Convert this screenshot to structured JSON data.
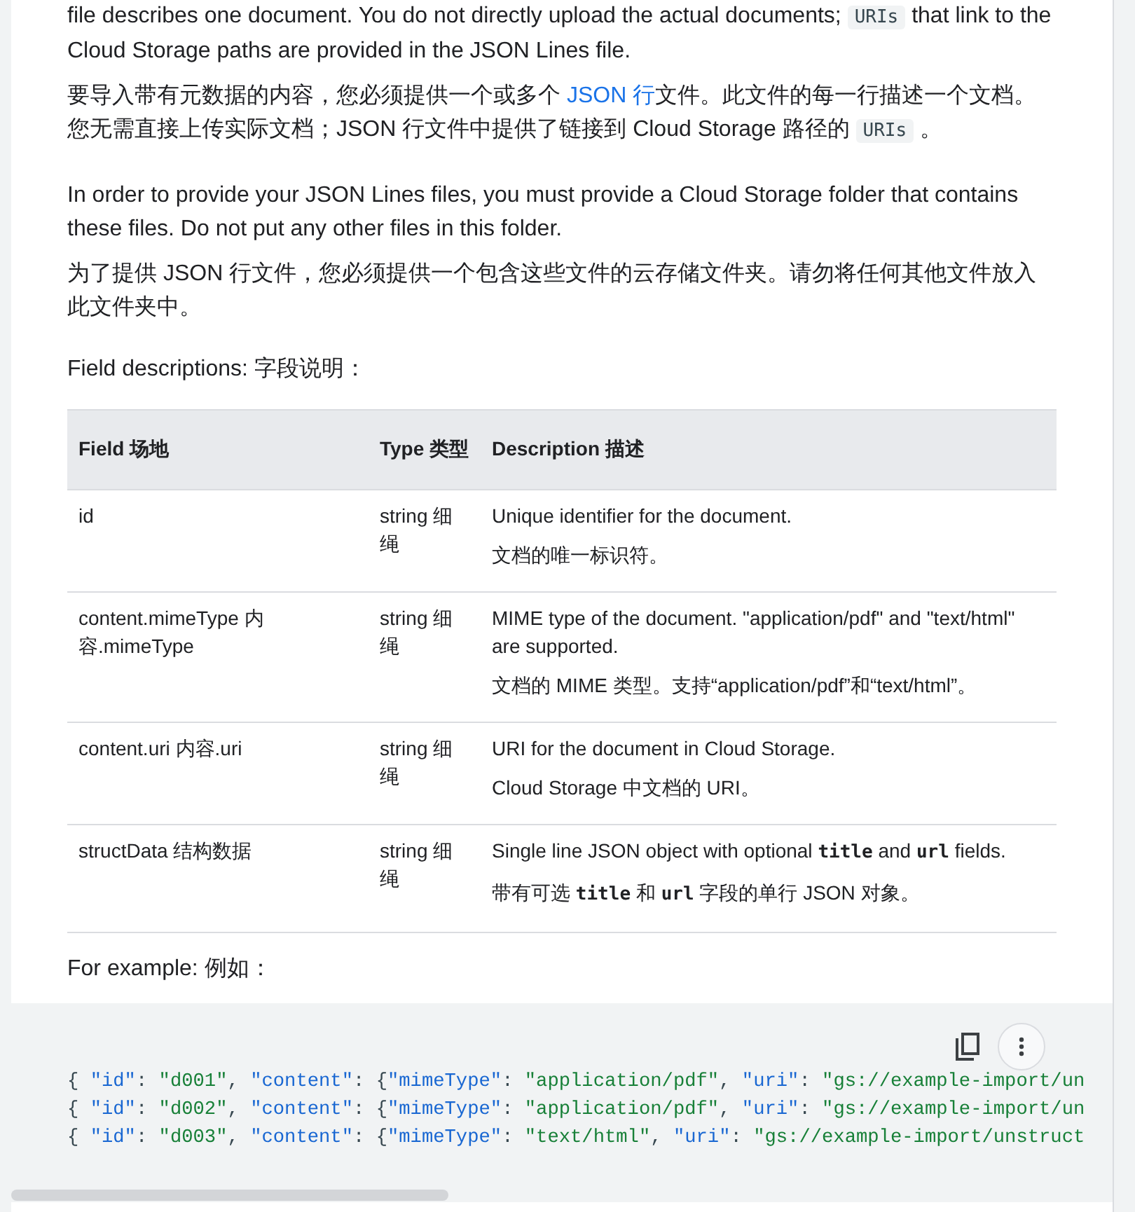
{
  "groups": [
    {
      "en": [
        {
          "kind": "text",
          "text": "file describes one document. You do not directly upload the actual documents; "
        },
        {
          "kind": "code",
          "text": "URIs"
        },
        {
          "kind": "text",
          "text": " that link to the Cloud Storage paths are provided in the JSON Lines file."
        }
      ],
      "zh": [
        {
          "kind": "text",
          "text": "要导入带有元数据的内容，您必须提供一个或多个 "
        },
        {
          "kind": "link",
          "text": "JSON 行"
        },
        {
          "kind": "text",
          "text": "文件。此文件的每一行描述一个文档。您无需直接上传实际文档；JSON 行文件中提供了链接到 Cloud Storage 路径的 "
        },
        {
          "kind": "code",
          "text": "URIs"
        },
        {
          "kind": "text",
          "text": " 。"
        }
      ]
    },
    {
      "en": [
        {
          "kind": "text",
          "text": "In order to provide your JSON Lines files, you must provide a Cloud Storage folder that contains these files. Do not put any other files in this folder."
        }
      ],
      "zh": [
        {
          "kind": "text",
          "text": "为了提供 JSON 行文件，您必须提供一个包含这些文件的云存储文件夹。请勿将任何其他文件放入此文件夹中。"
        }
      ]
    }
  ],
  "table_intro": "Field descriptions:  字段说明：",
  "table": {
    "columns": [
      "Field  场地",
      "Type  类型",
      "Description  描述"
    ],
    "rows": [
      {
        "field": "id",
        "type": "string  细绳",
        "desc_en": [
          {
            "kind": "text",
            "text": "Unique identifier for the document."
          }
        ],
        "desc_zh": [
          {
            "kind": "text",
            "text": "文档的唯一标识符。"
          }
        ]
      },
      {
        "field": "content.mimeType  内容.mimeType",
        "type": "string  细绳",
        "desc_en": [
          {
            "kind": "text",
            "text": "MIME type of the document. \"application/pdf\" and \"text/html\" are supported."
          }
        ],
        "desc_zh": [
          {
            "kind": "text",
            "text": "文档的 MIME 类型。支持“application/pdf”和“text/html”。"
          }
        ]
      },
      {
        "field": "content.uri  内容.uri",
        "type": "string  细绳",
        "desc_en": [
          {
            "kind": "text",
            "text": "URI for the document in Cloud Storage."
          }
        ],
        "desc_zh": [
          {
            "kind": "text",
            "text": "Cloud Storage 中文档的 URI。"
          }
        ]
      },
      {
        "field": "structData  结构数据",
        "type": "string  细绳",
        "desc_en": [
          {
            "kind": "text",
            "text": "Single line JSON object with optional "
          },
          {
            "kind": "mono",
            "text": "title"
          },
          {
            "kind": "text",
            "text": " and "
          },
          {
            "kind": "mono",
            "text": "url"
          },
          {
            "kind": "text",
            "text": " fields."
          }
        ],
        "desc_zh": [
          {
            "kind": "text",
            "text": "带有可选 "
          },
          {
            "kind": "mono",
            "text": "title"
          },
          {
            "kind": "text",
            "text": " 和 "
          },
          {
            "kind": "mono",
            "text": "url"
          },
          {
            "kind": "text",
            "text": " 字段的单行 JSON 对象。"
          }
        ]
      }
    ]
  },
  "example_intro": "For example:  例如：",
  "code_lines": [
    [
      {
        "kind": "punct",
        "text": "{ "
      },
      {
        "kind": "key",
        "text": "\"id\""
      },
      {
        "kind": "punct",
        "text": ": "
      },
      {
        "kind": "str",
        "text": "\"d001\""
      },
      {
        "kind": "punct",
        "text": ", "
      },
      {
        "kind": "key",
        "text": "\"content\""
      },
      {
        "kind": "punct",
        "text": ": {"
      },
      {
        "kind": "key",
        "text": "\"mimeType\""
      },
      {
        "kind": "punct",
        "text": ": "
      },
      {
        "kind": "str",
        "text": "\"application/pdf\""
      },
      {
        "kind": "punct",
        "text": ", "
      },
      {
        "kind": "key",
        "text": "\"uri\""
      },
      {
        "kind": "punct",
        "text": ": "
      },
      {
        "kind": "str",
        "text": "\"gs://example-import/un"
      }
    ],
    [
      {
        "kind": "punct",
        "text": "{ "
      },
      {
        "kind": "key",
        "text": "\"id\""
      },
      {
        "kind": "punct",
        "text": ": "
      },
      {
        "kind": "str",
        "text": "\"d002\""
      },
      {
        "kind": "punct",
        "text": ", "
      },
      {
        "kind": "key",
        "text": "\"content\""
      },
      {
        "kind": "punct",
        "text": ": {"
      },
      {
        "kind": "key",
        "text": "\"mimeType\""
      },
      {
        "kind": "punct",
        "text": ": "
      },
      {
        "kind": "str",
        "text": "\"application/pdf\""
      },
      {
        "kind": "punct",
        "text": ", "
      },
      {
        "kind": "key",
        "text": "\"uri\""
      },
      {
        "kind": "punct",
        "text": ": "
      },
      {
        "kind": "str",
        "text": "\"gs://example-import/un"
      }
    ],
    [
      {
        "kind": "punct",
        "text": "{ "
      },
      {
        "kind": "key",
        "text": "\"id\""
      },
      {
        "kind": "punct",
        "text": ": "
      },
      {
        "kind": "str",
        "text": "\"d003\""
      },
      {
        "kind": "punct",
        "text": ", "
      },
      {
        "kind": "key",
        "text": "\"content\""
      },
      {
        "kind": "punct",
        "text": ": {"
      },
      {
        "kind": "key",
        "text": "\"mimeType\""
      },
      {
        "kind": "punct",
        "text": ": "
      },
      {
        "kind": "str",
        "text": "\"text/html\""
      },
      {
        "kind": "punct",
        "text": ", "
      },
      {
        "kind": "key",
        "text": "\"uri\""
      },
      {
        "kind": "punct",
        "text": ": "
      },
      {
        "kind": "str",
        "text": "\"gs://example-import/unstruct"
      }
    ]
  ]
}
